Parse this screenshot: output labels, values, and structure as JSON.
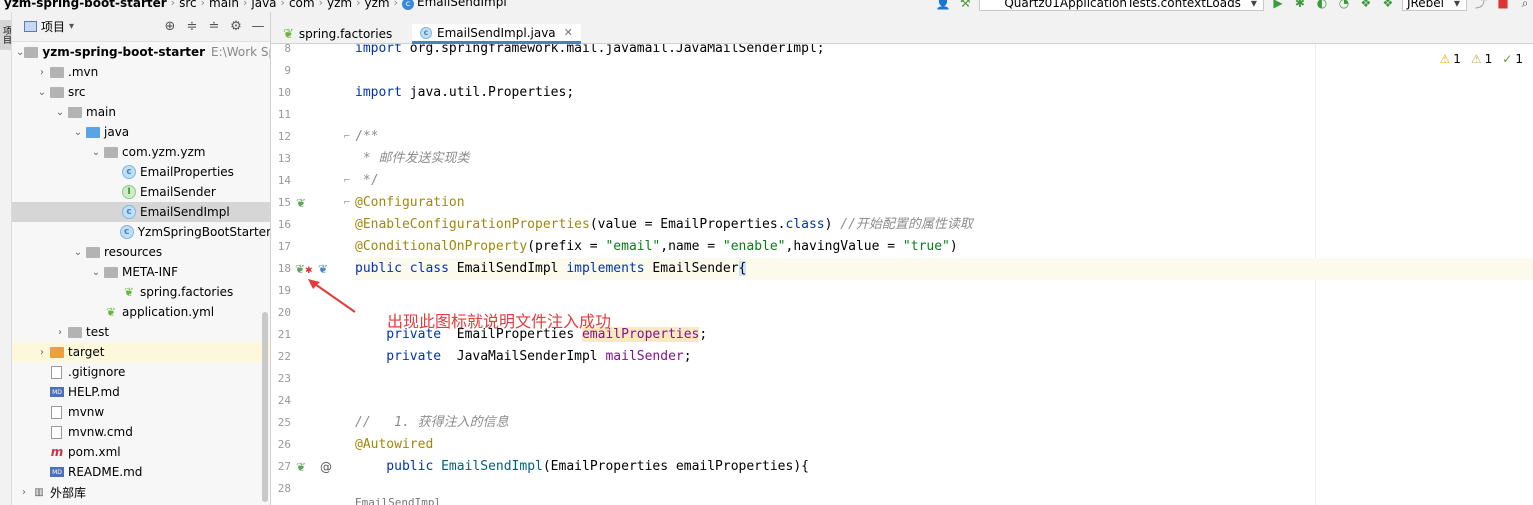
{
  "breadcrumbs": [
    "yzm-spring-boot-starter",
    "src",
    "main",
    "java",
    "com",
    "yzm",
    "yzm",
    "EmailSendImpl"
  ],
  "toolbar": {
    "run_config": "Quartz01ApplicationTests.contextLoads",
    "jrebel_label": "JRebel"
  },
  "tool_strip": {
    "project_tab": "项目"
  },
  "project_panel": {
    "title": "项目",
    "tree": [
      {
        "label": "yzm-spring-boot-starter",
        "path": "E:\\Work Sp",
        "icon": "folder",
        "depth": 0,
        "expanded": true,
        "bold": true
      },
      {
        "label": ".mvn",
        "icon": "folder",
        "depth": 1,
        "expanded": false
      },
      {
        "label": "src",
        "icon": "folder",
        "depth": 1,
        "expanded": true
      },
      {
        "label": "main",
        "icon": "folder",
        "depth": 2,
        "expanded": true
      },
      {
        "label": "java",
        "icon": "folder-blue",
        "depth": 3,
        "expanded": true
      },
      {
        "label": "com.yzm.yzm",
        "icon": "package",
        "depth": 4,
        "expanded": true
      },
      {
        "label": "EmailProperties",
        "icon": "class",
        "depth": 5
      },
      {
        "label": "EmailSender",
        "icon": "interface",
        "depth": 5
      },
      {
        "label": "EmailSendImpl",
        "icon": "class",
        "depth": 5,
        "selected": true
      },
      {
        "label": "YzmSpringBootStarter",
        "icon": "class",
        "depth": 5
      },
      {
        "label": "resources",
        "icon": "folder",
        "depth": 3,
        "expanded": true
      },
      {
        "label": "META-INF",
        "icon": "folder",
        "depth": 4,
        "expanded": true
      },
      {
        "label": "spring.factories",
        "icon": "spring",
        "depth": 5
      },
      {
        "label": "application.yml",
        "icon": "spring",
        "depth": 4
      },
      {
        "label": "test",
        "icon": "folder",
        "depth": 2,
        "expanded": false
      },
      {
        "label": "target",
        "icon": "folder-orange",
        "depth": 1,
        "expanded": false,
        "highlight": true
      },
      {
        "label": ".gitignore",
        "icon": "file",
        "depth": 1
      },
      {
        "label": "HELP.md",
        "icon": "md",
        "depth": 1
      },
      {
        "label": "mvnw",
        "icon": "file",
        "depth": 1
      },
      {
        "label": "mvnw.cmd",
        "icon": "file",
        "depth": 1
      },
      {
        "label": "pom.xml",
        "icon": "maven",
        "depth": 1
      },
      {
        "label": "README.md",
        "icon": "md",
        "depth": 1
      },
      {
        "label": "外部库",
        "icon": "libs",
        "depth": 0,
        "expanded": false
      }
    ]
  },
  "editor_tabs": [
    {
      "label": "spring.factories",
      "icon": "spring",
      "active": false
    },
    {
      "label": "EmailSendImpl.java",
      "icon": "class",
      "active": true
    }
  ],
  "inspections": [
    {
      "icon": "warning",
      "count": "1"
    },
    {
      "icon": "weak-warning",
      "count": "1"
    },
    {
      "icon": "typo",
      "count": "1"
    }
  ],
  "code": {
    "lines": [
      {
        "no": "8"
      },
      {
        "no": "9"
      },
      {
        "no": "10"
      },
      {
        "no": "11"
      },
      {
        "no": "12"
      },
      {
        "no": "13"
      },
      {
        "no": "14"
      },
      {
        "no": "15"
      },
      {
        "no": "16"
      },
      {
        "no": "17"
      },
      {
        "no": "18"
      },
      {
        "no": "19"
      },
      {
        "no": "20"
      },
      {
        "no": "21"
      },
      {
        "no": "22"
      },
      {
        "no": "23"
      },
      {
        "no": "24"
      },
      {
        "no": "25"
      },
      {
        "no": "26"
      },
      {
        "no": "27"
      },
      {
        "no": "28"
      }
    ],
    "tokens": {
      "l8_import": "import",
      "l8_rest": " org.springframework.mail.javamail.JavaMailSenderImpl;",
      "l10_import": "import",
      "l10_rest": " java.util.Properties;",
      "l12": "/**",
      "l13": " * 邮件发送实现类",
      "l14": " */",
      "l15": "@Configuration",
      "l16_ann": "@EnableConfigurationProperties",
      "l16_a": "(value = EmailProperties.",
      "l16_kw": "class",
      "l16_b": ") ",
      "l16_cmt": "//开始配置的属性读取",
      "l17_ann": "@ConditionalOnProperty",
      "l17_a": "(prefix = ",
      "l17_s1": "\"email\"",
      "l17_b": ",name = ",
      "l17_s2": "\"enable\"",
      "l17_c": ",havingValue = ",
      "l17_s3": "\"true\"",
      "l17_d": ")",
      "l18_kw1": "public class",
      "l18_a": " EmailSendImpl ",
      "l18_kw2": "implements",
      "l18_b": " EmailSender",
      "l18_brace": "{",
      "l21_kw": "    private",
      "l21_a": "  EmailProperties ",
      "l21_f": "emailProperties",
      "l21_b": ";",
      "l22_kw": "    private",
      "l22_a": "  JavaMailSenderImpl ",
      "l22_f": "mailSender",
      "l22_b": ";",
      "l25_cmt": "//   1. 获得注入的信息",
      "l26": "@Autowired",
      "l27_kw": "    public",
      "l27_m": " EmailSendImpl",
      "l27_a": "(EmailProperties emailProperties){"
    }
  },
  "annotation_text": "出现此图标就说明文件注入成功",
  "bottom_text": "EmailSendImpl",
  "colors": {
    "keyword": "#0033b3",
    "annotation": "#9e880d",
    "string": "#067d17",
    "comment": "#8c8c8c",
    "field": "#871094",
    "callout": "#e53b3b"
  }
}
